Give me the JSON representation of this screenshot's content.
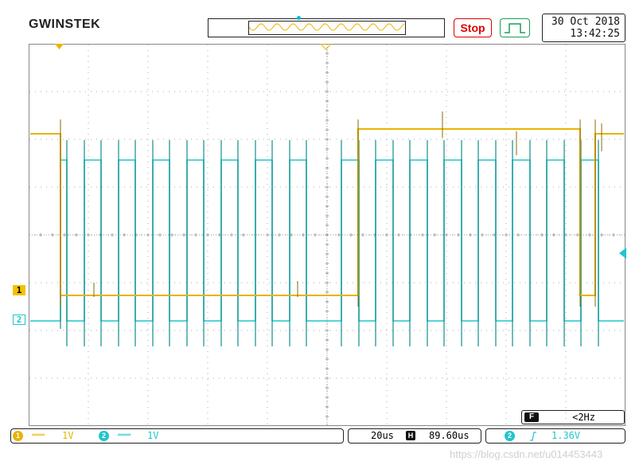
{
  "header": {
    "brand": "GWINSTEK",
    "status_button": "Stop",
    "date": "30 Oct 2018",
    "time": "13:42:25"
  },
  "channels": {
    "ch1_label": "1",
    "ch2_label": "2"
  },
  "trigger_frequency": {
    "f_label": "F",
    "value": "<2Hz"
  },
  "status_bar": {
    "ch1": {
      "num": "1",
      "coupling": "═══",
      "scale": "1V"
    },
    "ch2": {
      "num": "2",
      "coupling": "═══",
      "scale": "1V"
    },
    "timebase": "20us",
    "h_icon": "H",
    "h_position": "89.60us",
    "trigger": {
      "num": "2",
      "edge_icon": "rising-edge-icon",
      "level": "1.36V"
    }
  },
  "watermark": "https://blog.csdn.net/u014453443",
  "colors": {
    "ch1": "#e8b400",
    "ch2": "#20c6cc",
    "stop": "#dd0000",
    "trigger_ok": "#1b9d5a"
  }
}
